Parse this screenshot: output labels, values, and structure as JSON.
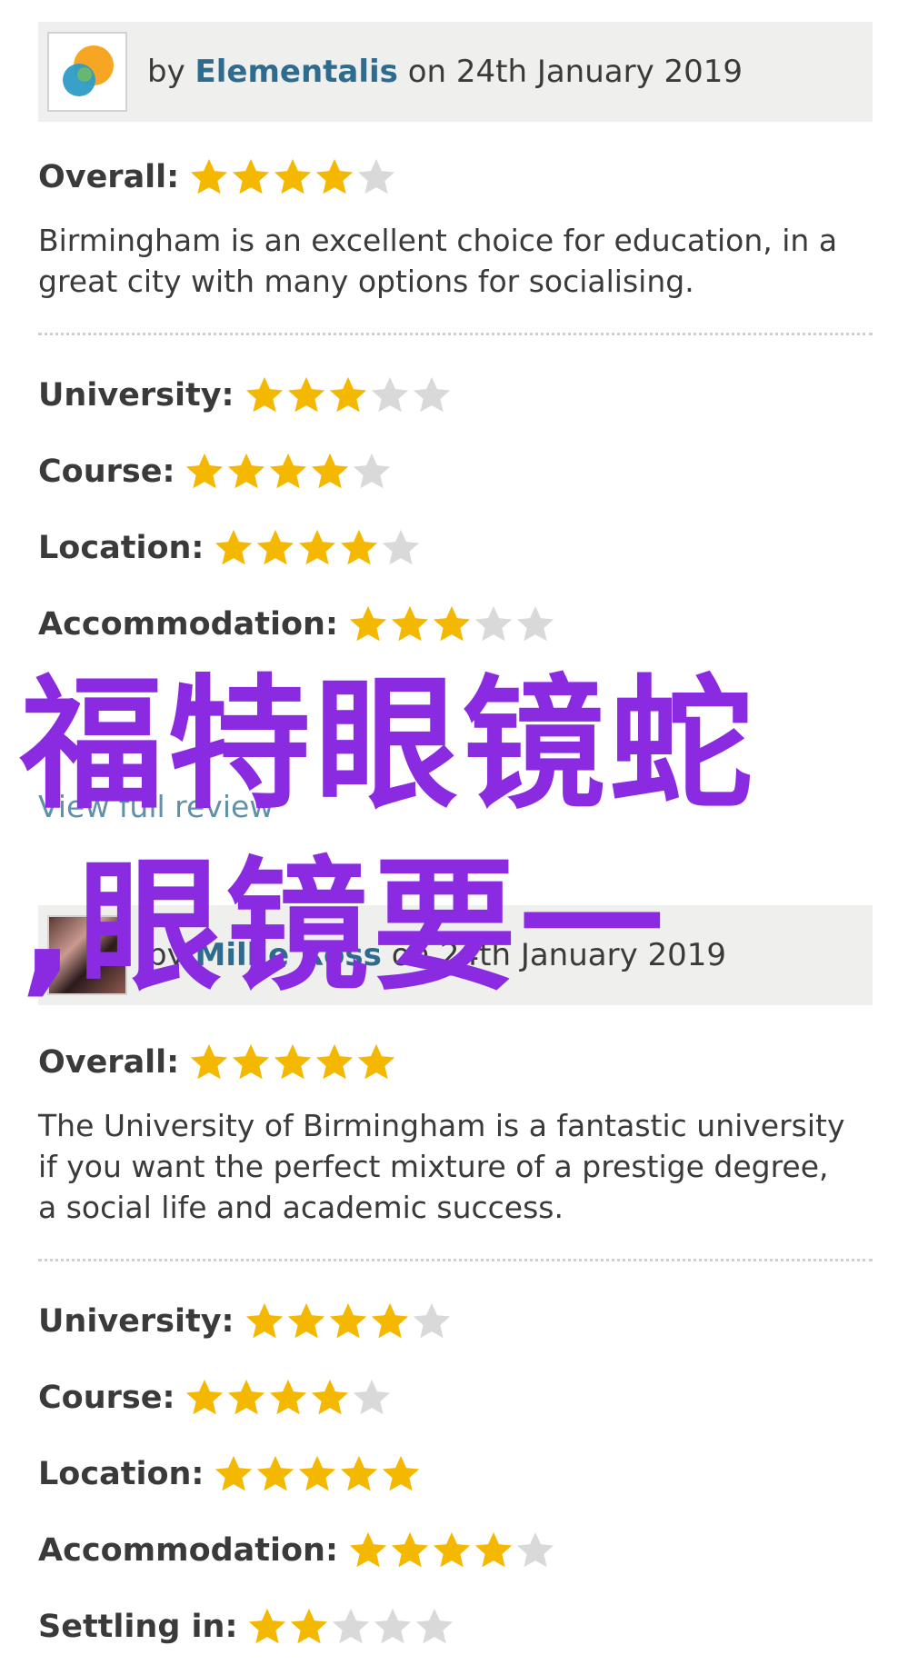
{
  "colors": {
    "star_filled": "#f5b800",
    "star_empty": "#d9d9d9",
    "author_link": "#2d6b8f",
    "header_bg": "#efefee",
    "watermark": "#8a2be2"
  },
  "reviews": [
    {
      "by_prefix": "by",
      "author": "Elementalis",
      "date_text": "on 24th January 2019",
      "overall": {
        "label": "Overall:",
        "rating": 4,
        "max": 5
      },
      "text": "Birmingham is an excellent choice for education, in a great city with many options for socialising.",
      "sub_ratings": [
        {
          "label": "University:",
          "rating": 3,
          "max": 5
        },
        {
          "label": "Course:",
          "rating": 4,
          "max": 5
        },
        {
          "label": "Location:",
          "rating": 4,
          "max": 5
        },
        {
          "label": "Accommodation:",
          "rating": 3,
          "max": 5
        }
      ]
    },
    {
      "by_prefix": "by",
      "author": "Millie Ross",
      "date_text": "on 24th January 2019",
      "overall": {
        "label": "Overall:",
        "rating": 5,
        "max": 5
      },
      "text": "The University of Birmingham is a fantastic university if you want the perfect mixture of a prestige degree, a social life and academic success.",
      "sub_ratings": [
        {
          "label": "University:",
          "rating": 4,
          "max": 5
        },
        {
          "label": "Course:",
          "rating": 4,
          "max": 5
        },
        {
          "label": "Location:",
          "rating": 5,
          "max": 5
        },
        {
          "label": "Accommodation:",
          "rating": 4,
          "max": 5
        },
        {
          "label": "Settling in:",
          "rating": 2,
          "max": 5
        }
      ]
    }
  ],
  "view_full_review": "View full review",
  "watermark": {
    "line1": "福特眼镜蛇",
    "line2": ",眼镜要一"
  }
}
